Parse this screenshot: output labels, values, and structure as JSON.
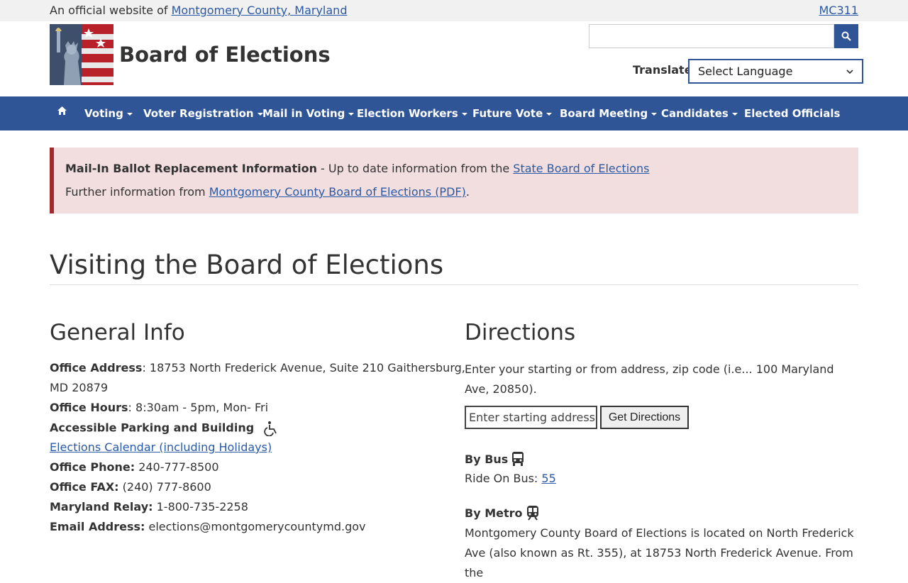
{
  "topbar": {
    "prefix": "An official website of",
    "county_link": "Montgomery County, Maryland",
    "mc311_link": "MC311"
  },
  "header": {
    "title": "Board of Elections",
    "search_placeholder": "",
    "translate_label": "Translate",
    "language_selected": "Select Language"
  },
  "nav": {
    "home_icon": "home-icon",
    "items": [
      {
        "label": "Voting"
      },
      {
        "label": "Voter Registration"
      },
      {
        "label": "Mail in Voting"
      },
      {
        "label": "Election Workers"
      },
      {
        "label": "Future Vote"
      },
      {
        "label": "Board Meeting"
      },
      {
        "label": "Candidates"
      },
      {
        "label": "Elected Officials"
      }
    ]
  },
  "alert": {
    "bold": "Mail-In Ballot Replacement Information",
    "text1": " - Up to date information from the ",
    "link1": "State Board of Elections",
    "text2": "Further information from ",
    "link2": "Montgomery County Board of Elections (PDF)",
    "text2_end": "."
  },
  "page": {
    "title": "Visiting the Board of Elections"
  },
  "general": {
    "heading": "General Info",
    "address_label": "Office Address",
    "address_value": ": 18753 North Frederick Avenue, Suite 210 Gaithersburg,",
    "address_value2": "MD 20879",
    "hours_label": "Office Hours",
    "hours_value": ": 8:30am - 5pm, Mon- Fri",
    "parking_label": "Accessible Parking and Building",
    "calendar_link": "Elections Calendar (including Holidays)",
    "phone_label": "Office Phone:",
    "phone_value": " 240-777-8500",
    "fax_label": "Office FAX:",
    "fax_value": " (240) 777-8600",
    "relay_label": "Maryland Relay:",
    "relay_value": " 1-800-735-2258",
    "email_label": "Email Address:",
    "email_value": " elections@montgomerycountymd.gov"
  },
  "directions": {
    "heading": "Directions",
    "intro": "Enter your starting or from address, zip code (i.e... 100 Maryland Ave, 20850).",
    "input_placeholder": "Enter starting address",
    "button_label": "Get Directions",
    "bus_heading": "By Bus",
    "bus_text": "Ride On Bus: ",
    "bus_link": "55",
    "metro_heading": "By Metro",
    "metro_text": "Montgomery County Board of Elections is located on North Frederick Ave (also known as Rt. 355), at 18753 North Frederick Avenue. From the"
  },
  "colors": {
    "nav_bg": "#2f5597",
    "alert_bg": "#f2dede",
    "alert_border": "#a12a2f",
    "link": "#2a5aa5"
  }
}
